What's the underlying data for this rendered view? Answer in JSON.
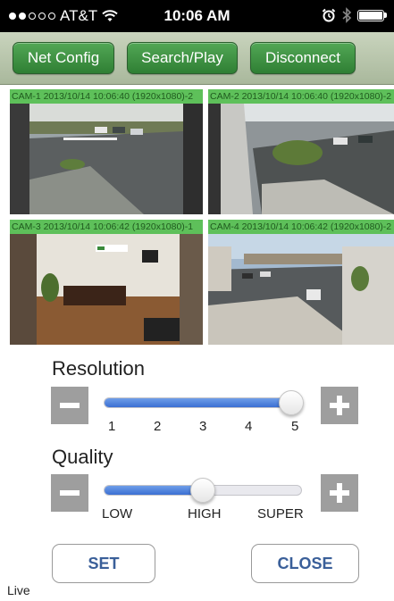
{
  "status_bar": {
    "carrier": "AT&T",
    "time": "10:06 AM",
    "icons": [
      "signal-dots-icon",
      "wifi-icon",
      "alarm-icon",
      "bluetooth-icon",
      "battery-icon"
    ]
  },
  "toolbar": {
    "net_config": "Net Config",
    "search_play": "Search/Play",
    "disconnect": "Disconnect"
  },
  "cameras": [
    {
      "label": "CAM-1 2013/10/14 10:06:40 (1920x1080)-2"
    },
    {
      "label": "CAM-2 2013/10/14 10:06:40 (1920x1080)-2"
    },
    {
      "label": "CAM-3 2013/10/14 10:06:42 (1920x1080)-1"
    },
    {
      "label": "CAM-4 2013/10/14 10:06:42 (1920x1080)-2"
    }
  ],
  "resolution": {
    "title": "Resolution",
    "ticks": [
      "1",
      "2",
      "3",
      "4",
      "5"
    ],
    "selected_index": 4,
    "value_fraction": 1.0
  },
  "quality": {
    "title": "Quality",
    "ticks": [
      "LOW",
      "HIGH",
      "SUPER"
    ],
    "selected": "HIGH",
    "value_fraction": 0.5
  },
  "actions": {
    "set": "SET",
    "close": "CLOSE"
  },
  "mode": "Live",
  "colors": {
    "toolbar_button": "#3f9444",
    "camera_label_bg": "#5ec05a",
    "slider_fill": "#3b6fd3",
    "stepper_bg": "#9e9e9e",
    "action_text": "#3a5f99"
  }
}
